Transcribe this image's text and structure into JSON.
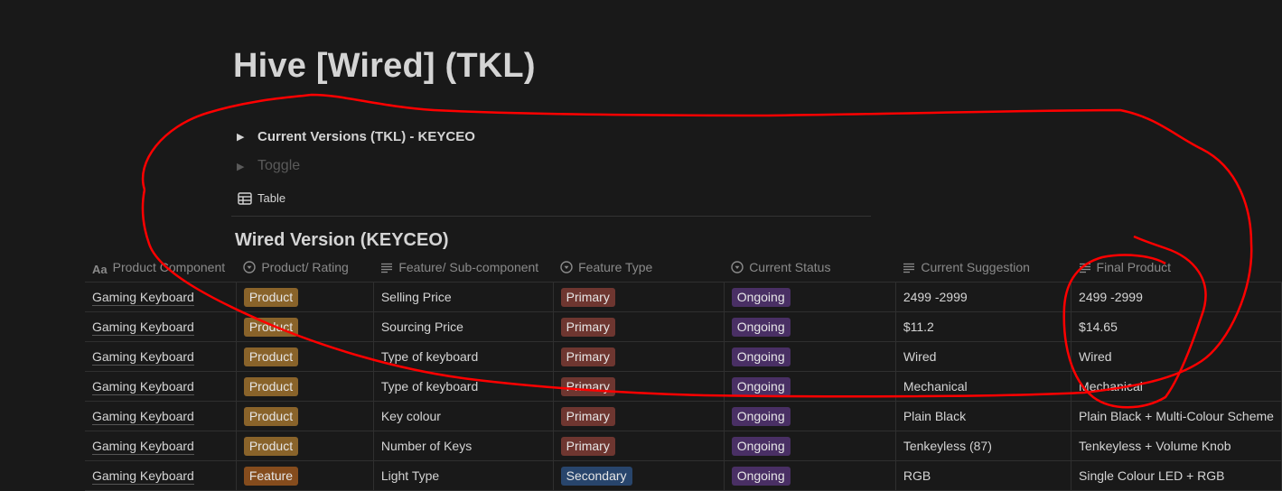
{
  "page": {
    "title": "Hive [Wired] (TKL)"
  },
  "toggles": [
    {
      "label": "Current Versions (TKL) - KEYCEO",
      "icon": "triangle-right-icon"
    },
    {
      "label": "Toggle",
      "icon": "triangle-right-icon",
      "placeholder": true
    }
  ],
  "view": {
    "tab_label": "Table",
    "tab_icon": "table-icon"
  },
  "database": {
    "title": "Wired Version (KEYCEO)",
    "columns": [
      {
        "label": "Product Component",
        "icon": "title-aa-icon"
      },
      {
        "label": "Product/ Rating",
        "icon": "select-icon"
      },
      {
        "label": "Feature/ Sub-component",
        "icon": "text-lines-icon"
      },
      {
        "label": "Feature Type",
        "icon": "select-icon"
      },
      {
        "label": "Current Status",
        "icon": "select-icon"
      },
      {
        "label": "Current Suggestion",
        "icon": "text-lines-icon"
      },
      {
        "label": "Final Product",
        "icon": "text-lines-icon"
      }
    ],
    "rows": [
      {
        "component": "Gaming Keyboard",
        "rating": "Product",
        "feature": "Selling Price",
        "type": "Primary",
        "status": "Ongoing",
        "suggestion": "2499 -2999",
        "final": "2499 -2999"
      },
      {
        "component": "Gaming Keyboard",
        "rating": "Product",
        "feature": "Sourcing Price",
        "type": "Primary",
        "status": "Ongoing",
        "suggestion": "$11.2",
        "final": "$14.65"
      },
      {
        "component": "Gaming Keyboard",
        "rating": "Product",
        "feature": "Type of keyboard",
        "type": "Primary",
        "status": "Ongoing",
        "suggestion": "Wired",
        "final": "Wired"
      },
      {
        "component": "Gaming Keyboard",
        "rating": "Product",
        "feature": "Type of keyboard",
        "type": "Primary",
        "status": "Ongoing",
        "suggestion": "Mechanical",
        "final": "Mechanical"
      },
      {
        "component": "Gaming Keyboard",
        "rating": "Product",
        "feature": "Key colour",
        "type": "Primary",
        "status": "Ongoing",
        "suggestion": "Plain Black",
        "final": "Plain Black + Multi-Colour Scheme"
      },
      {
        "component": "Gaming Keyboard",
        "rating": "Product",
        "feature": "Number of Keys",
        "type": "Primary",
        "status": "Ongoing",
        "suggestion": "Tenkeyless (87)",
        "final": "Tenkeyless + Volume Knob"
      },
      {
        "component": "Gaming Keyboard",
        "rating": "Feature",
        "feature": "Light Type",
        "type": "Secondary",
        "status": "Ongoing",
        "suggestion": "RGB",
        "final": "Single Colour LED + RGB"
      }
    ],
    "tag_colors": {
      "Product": "#89632a",
      "Feature": "#854c1d",
      "Primary": "#6e3630",
      "Secondary": "#28456c",
      "Ongoing": "#492f64"
    }
  },
  "annotations": {
    "stroke_color": "#ff0000"
  }
}
